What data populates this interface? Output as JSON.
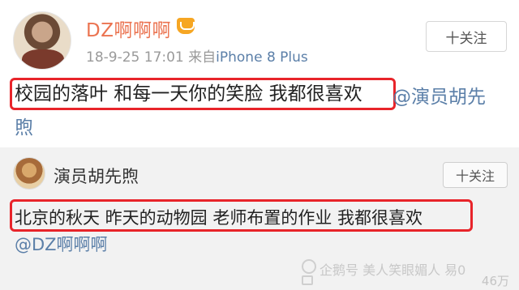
{
  "post": {
    "username": "DZ啊啊啊",
    "timestamp": "18-9-25 17:01",
    "source_prefix": "来自",
    "source": "iPhone 8 Plus",
    "follow_label": "十关注",
    "content": "校园的落叶 和每一天你的笑脸 我都很喜欢",
    "mention_part1": "@演员胡先",
    "mention_part2": "煦"
  },
  "repost": {
    "username": "演员胡先煦",
    "follow_label": "十关注",
    "content": "北京的秋天 昨天的动物园 老师布置的作业 我都很喜欢",
    "mention": "@DZ啊啊啊"
  },
  "watermark": "企鹅号 美人笑眼媚人 易0",
  "stats": "46万",
  "colors": {
    "username": "#eb7350",
    "link": "#5b7fa8",
    "highlight": "#e8242a",
    "card_bg": "#f2f2f2"
  }
}
